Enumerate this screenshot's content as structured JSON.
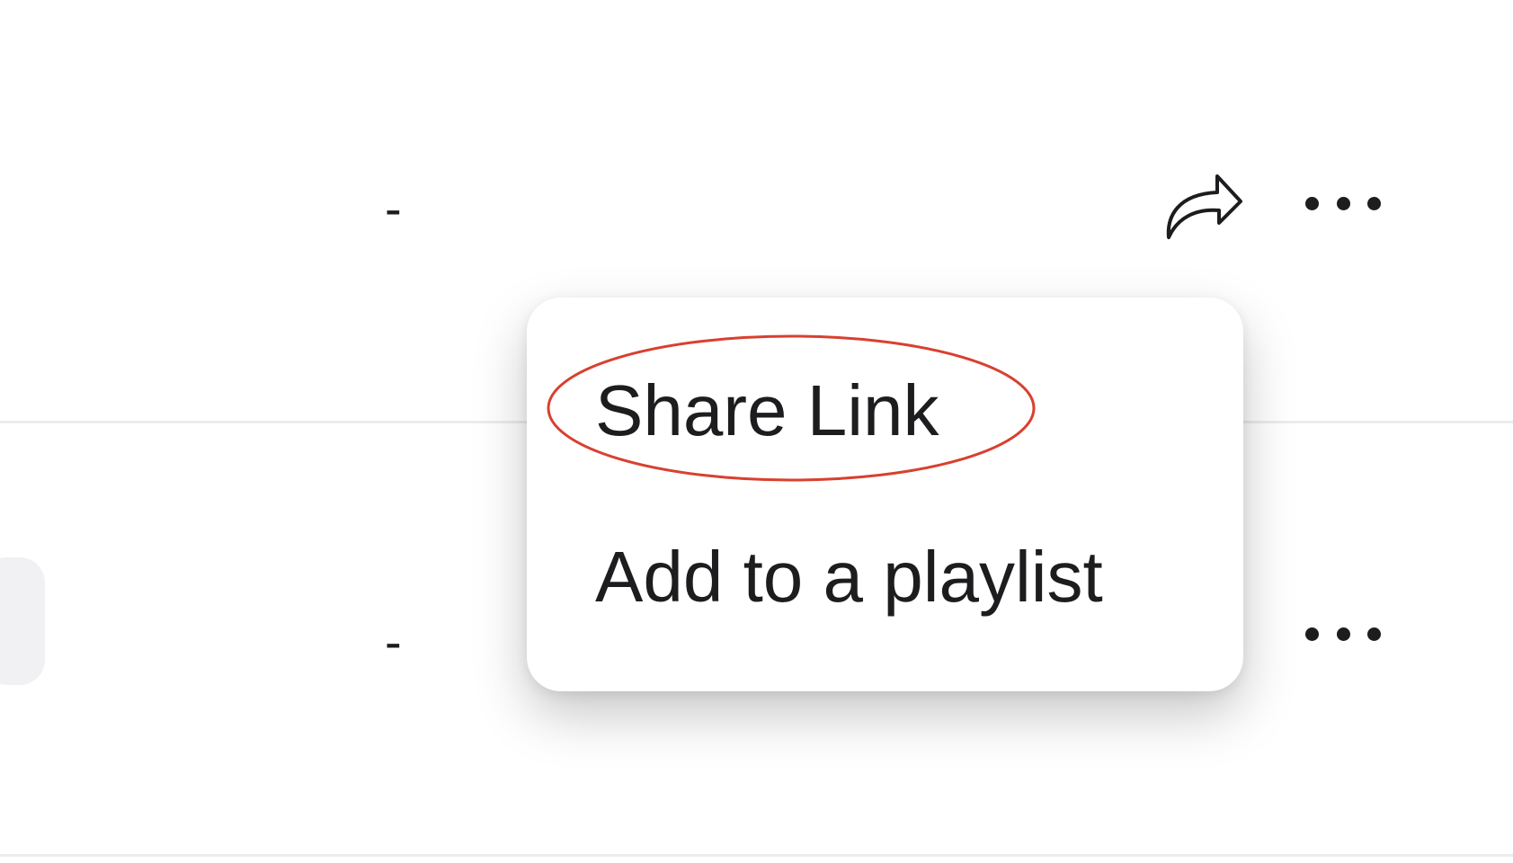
{
  "rows": [
    {
      "dash": "-"
    },
    {
      "dash": "-"
    }
  ],
  "context_menu": {
    "items": [
      {
        "label": "Share Link"
      },
      {
        "label": "Add to a playlist"
      }
    ],
    "highlight_color": "#d9402f"
  },
  "icons": {
    "share": "share-arrow-icon",
    "more": "more-horizontal-icon"
  }
}
